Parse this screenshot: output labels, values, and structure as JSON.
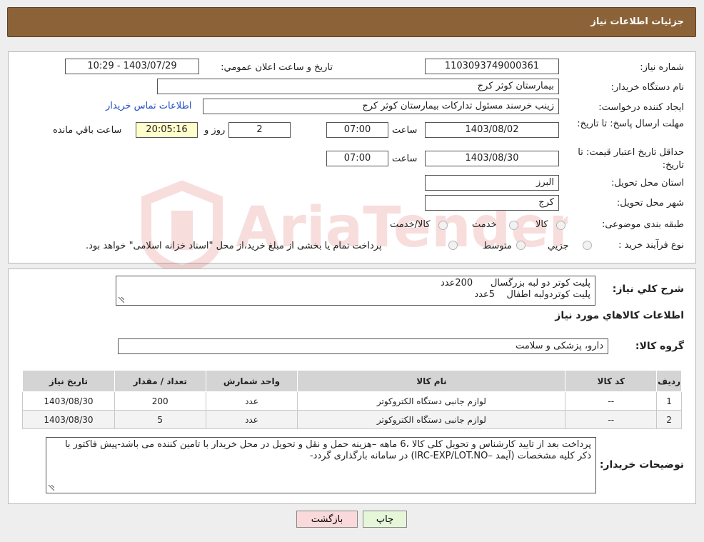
{
  "header": {
    "title": "جزئیات اطلاعات نیاز"
  },
  "need": {
    "number_label": "شماره نیاز:",
    "number": "1103093749000361",
    "announce_label": "تاريخ و ساعت اعلان عمومي:",
    "announce": "1403/07/29 - 10:29",
    "buyer_label": "نام دستگاه خريدار:",
    "buyer": "بیمارستان کوثر کرج",
    "creator_label": "ايجاد كننده درخواست:",
    "creator": "زینب خرسند مسئول تدارکات بیمارستان کوثر کرج",
    "contact_link": "اطلاعات تماس خريدار",
    "deadline_label": "مهلت ارسال پاسخ: تا تاريخ:",
    "deadline_date": "1403/08/02",
    "time_label": "ساعت",
    "deadline_time": "07:00",
    "days": "2",
    "days_label": "روز و",
    "remaining": "20:05:16",
    "remaining_label": "ساعت باقي مانده",
    "validity_label": "حداقل تاريخ اعتبار قيمت: تا تاريخ:",
    "validity_date": "1403/08/30",
    "validity_time": "07:00",
    "province_label": "استان محل تحويل:",
    "province": "البرز",
    "city_label": "شهر محل تحويل:",
    "city": "کرج",
    "category_label": "طبقه بندی موضوعی:",
    "category_options": [
      "كالا",
      "خدمت",
      "كالا/خدمت"
    ],
    "process_label": "نوع فرآيند خريد :",
    "process_options": [
      "جزيي",
      "متوسط"
    ],
    "process_note": "پرداخت تمام یا بخشی از مبلغ خرید،از محل \"اسناد خزانه اسلامی\" خواهد بود."
  },
  "summary": {
    "label": "شرح كلي نياز:",
    "line1": "پلیت کوتر دو لبه بزرگسال      200عدد",
    "line2": "پلیت کوتردولبه اطفال    5عدد"
  },
  "goods": {
    "title": "اطلاعات كالاهاي مورد نياز",
    "group_label": "گروه كالا:",
    "group": "دارو، پزشکی و سلامت",
    "columns": [
      "رديف",
      "كد كالا",
      "نام كالا",
      "واحد شمارش",
      "تعداد / مقدار",
      "تاريخ نياز"
    ],
    "rows": [
      {
        "idx": "1",
        "code": "--",
        "name": "لوازم جانبی دستگاه الکتروکوتر",
        "unit": "عدد",
        "qty": "200",
        "date": "1403/08/30"
      },
      {
        "idx": "2",
        "code": "--",
        "name": "لوازم جانبی دستگاه الکتروکوتر",
        "unit": "عدد",
        "qty": "5",
        "date": "1403/08/30"
      }
    ]
  },
  "notes": {
    "label": "توضيحات خريدار:",
    "text": "پرداخت بعد از تایید کارشناس و تحویل کلی کالا ،6 ماهه –هزینه حمل و نقل و تحویل در محل خریدار با تامین کننده می باشد-پیش فاکتور با ذکر کلیه مشخصات (آیمد –IRC-EXP/LOT.NO) در سامانه بارگذاری گردد-"
  },
  "buttons": {
    "print": "چاپ",
    "back": "بازگشت"
  },
  "colors": {
    "header": "#8c6239",
    "back_button": "#f9d9d9",
    "print_button": "#e6f7d9",
    "link": "#1f4fc4"
  }
}
